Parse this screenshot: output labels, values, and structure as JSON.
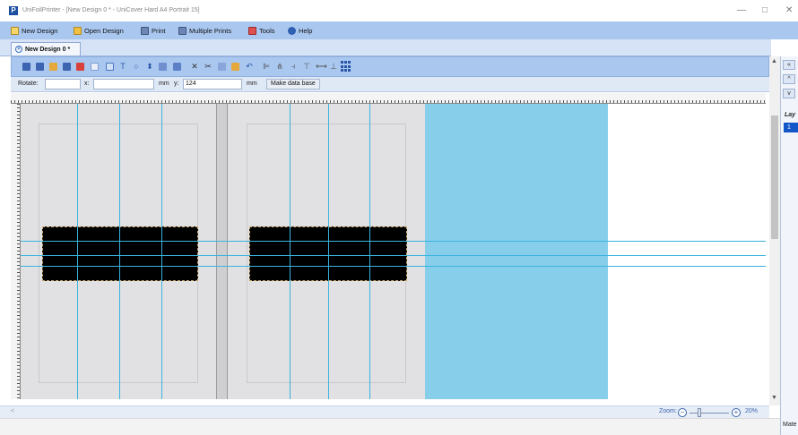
{
  "window": {
    "title": "UniFoilPrinter - [New Design 0 * - UniCover Hard A4 Portrait 15]",
    "logo_letter": "P",
    "minimize": "—",
    "maximize": "□",
    "close": "✕"
  },
  "menu": {
    "new_design": "New Design",
    "open_design": "Open Design",
    "print": "Print",
    "multiple_prints": "Multiple Prints",
    "tools": "Tools",
    "help": "Help"
  },
  "tab": {
    "label": "New Design 0 *",
    "close": "×"
  },
  "props": {
    "rotate_label": "Rotate:",
    "rotate_value": "",
    "x_label": "x:",
    "x_value": "",
    "x_unit": "mm",
    "y_label": "y:",
    "y_value": "124",
    "y_unit": "mm",
    "make_db_button": "Make data base"
  },
  "side_panel": {
    "collapse": "«",
    "close": "✕",
    "up": "^",
    "down": "v",
    "layers_label": "Lay",
    "layer_item": "1",
    "bottom_label": "Mate"
  },
  "status": {
    "left_arrow": "<",
    "zoom_label": "Zoom:",
    "zoom_minus": "−",
    "zoom_plus": "+",
    "zoom_value": "20%"
  },
  "colors": {
    "menubar": "#a9c7ef",
    "board": "#e1e1e3",
    "blue_panel": "#87ceea",
    "guide": "#3ab4de",
    "block": "#000000"
  }
}
